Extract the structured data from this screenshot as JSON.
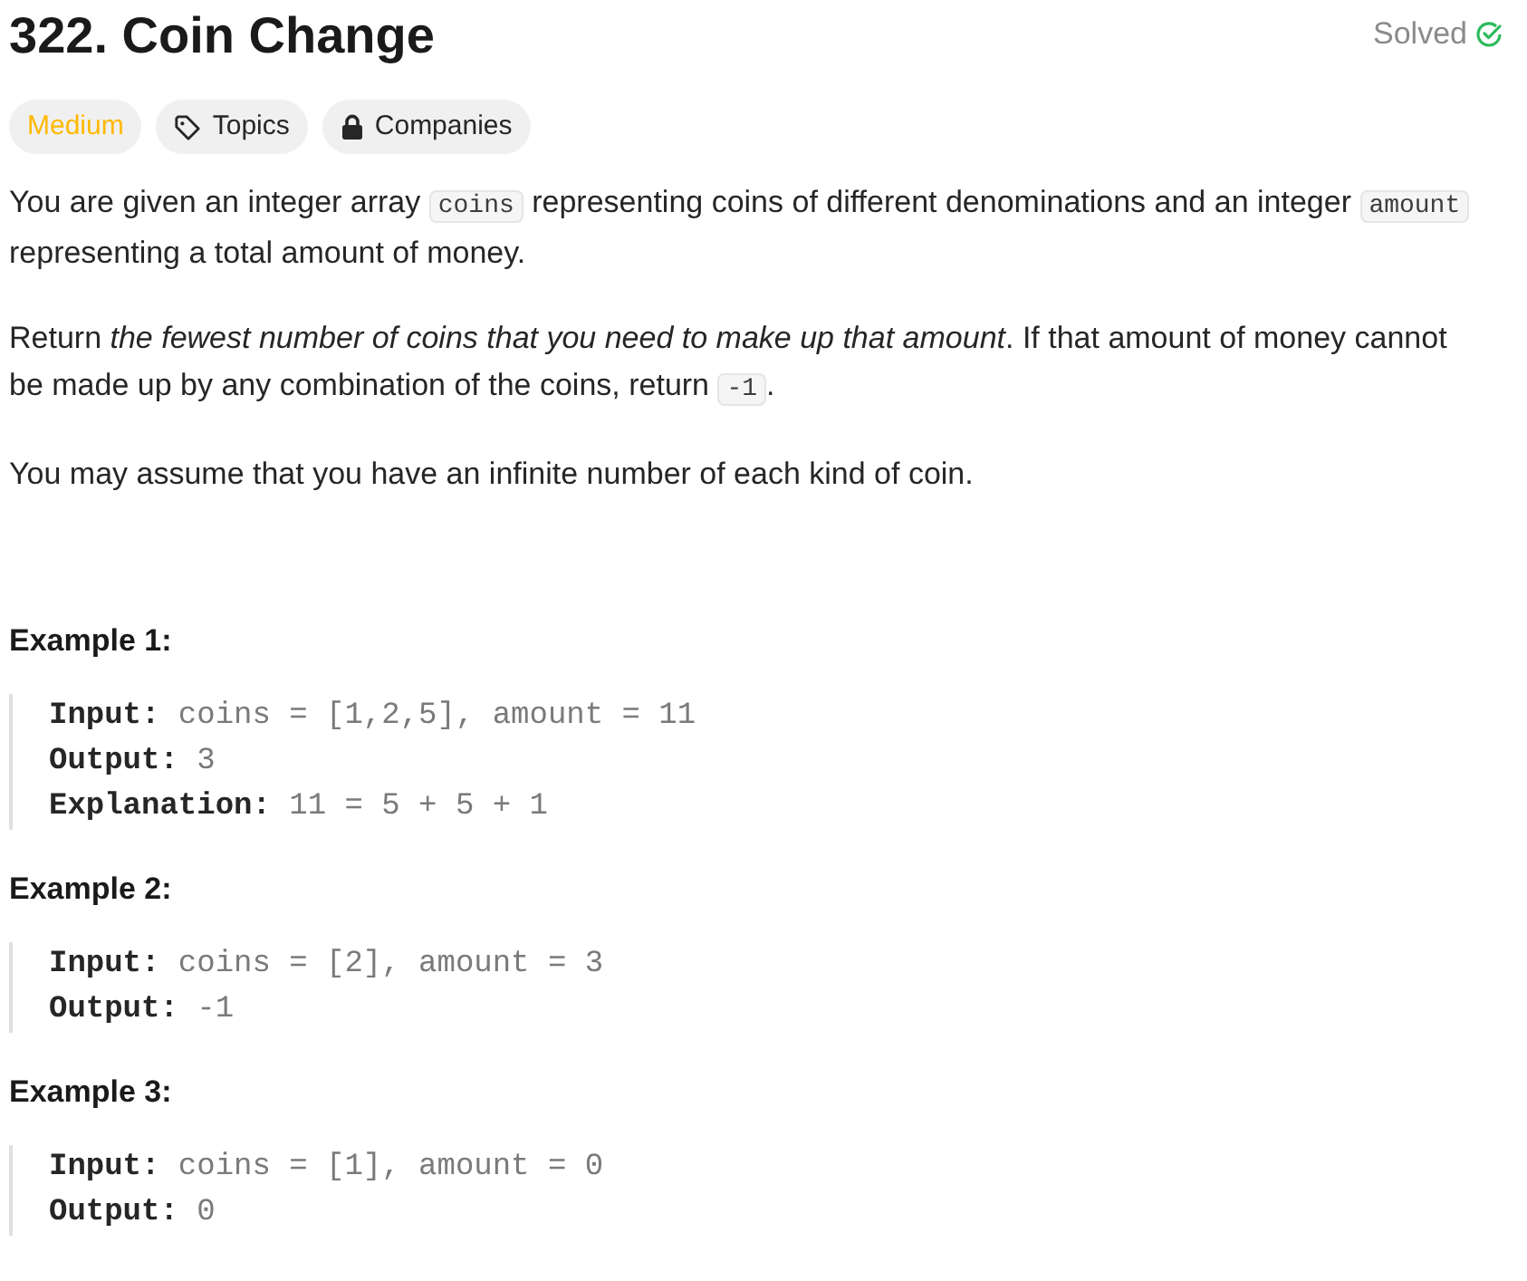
{
  "title": "322. Coin Change",
  "status": {
    "text": "Solved",
    "solved": true
  },
  "tags": [
    {
      "kind": "difficulty",
      "label": "Medium",
      "color": "#ffb800"
    },
    {
      "kind": "topics",
      "label": "Topics"
    },
    {
      "kind": "companies",
      "label": "Companies"
    }
  ],
  "description": [
    [
      {
        "kind": "text",
        "text": "You are given an integer array "
      },
      {
        "kind": "code",
        "text": "coins"
      },
      {
        "kind": "text",
        "text": " representing coins of different denominations and an integer "
      },
      {
        "kind": "code",
        "text": "amount"
      },
      {
        "kind": "text",
        "text": " representing a total amount of money."
      }
    ],
    [
      {
        "kind": "text",
        "text": "Return *the fewest number of coins that you need to make up that amount*. If that amount of money cannot be made up by any combination of the coins, return "
      },
      {
        "kind": "code",
        "text": "-1"
      },
      {
        "kind": "text",
        "text": "."
      }
    ],
    [
      {
        "kind": "text",
        "text": "You may assume that you have an infinite number of each kind of coin."
      }
    ]
  ],
  "examples": [
    {
      "heading": "Example 1:",
      "lines": [
        {
          "label": "Input:",
          "value": "coins = [1,2,5], amount = 11"
        },
        {
          "label": "Output:",
          "value": "3"
        },
        {
          "label": "Explanation:",
          "value": "11 = 5 + 5 + 1"
        }
      ]
    },
    {
      "heading": "Example 2:",
      "lines": [
        {
          "label": "Input:",
          "value": "coins = [2], amount = 3"
        },
        {
          "label": "Output:",
          "value": "-1"
        }
      ]
    },
    {
      "heading": "Example 3:",
      "lines": [
        {
          "label": "Input:",
          "value": "coins = [1], amount = 0"
        },
        {
          "label": "Output:",
          "value": "0"
        }
      ]
    }
  ]
}
